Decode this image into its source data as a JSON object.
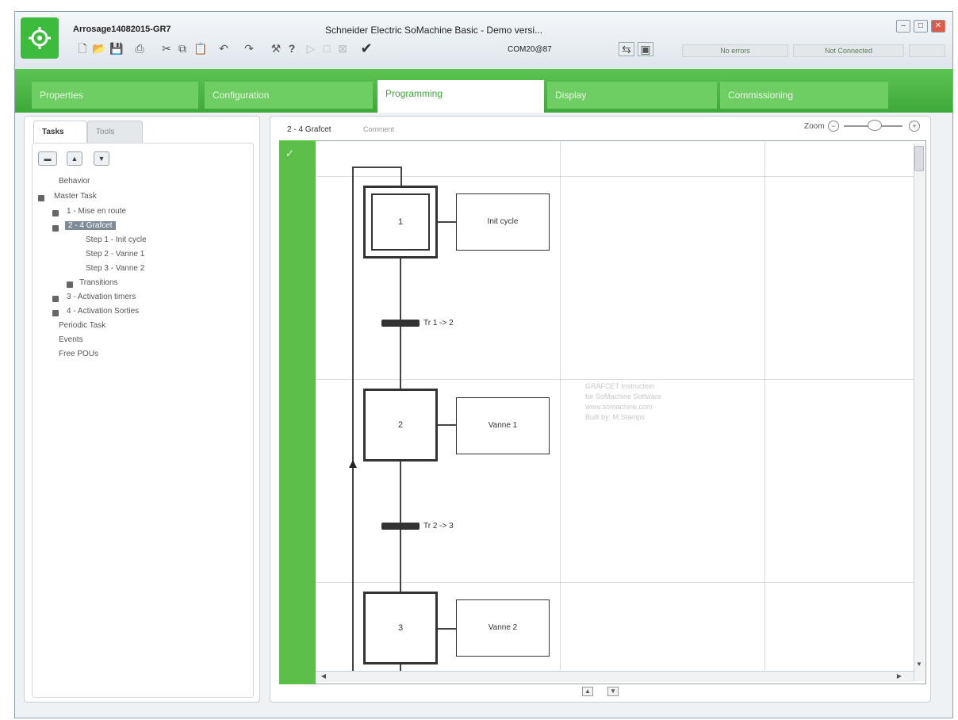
{
  "window": {
    "project_name": "Arrosage14082015-GR7",
    "title": "Schneider Electric SoMachine Basic - Demo versi...",
    "com_port": "COM20@87",
    "status_errors": "No errors",
    "status_connection": "Not Connected",
    "min_glyph": "–",
    "max_glyph": "□",
    "close_glyph": "✕"
  },
  "toolbar": {
    "icons": [
      "new-icon",
      "open-icon",
      "save-icon",
      "print-icon",
      "cut-icon",
      "copy-icon",
      "paste-icon",
      "undo-icon",
      "redo-icon",
      "tools-icon",
      "help-icon",
      "run-icon",
      "stop-icon",
      "reset-icon",
      "check-icon",
      "compare-icon",
      "monitor-icon"
    ],
    "glyphs": {
      "new": "🗋",
      "open": "📂",
      "save": "💾",
      "print": "⎙",
      "cut": "✂",
      "copy": "⧉",
      "paste": "📋",
      "undo": "↶",
      "redo": "↷",
      "tools": "⚒",
      "help": "?",
      "run": "▷",
      "stop": "□",
      "reset": "⊠",
      "check": "✔",
      "compare": "⇆",
      "monitor": "▣"
    }
  },
  "tabs": [
    "Properties",
    "Configuration",
    "Programming",
    "Display",
    "Commissioning"
  ],
  "active_tab": "Programming",
  "left_panel": {
    "subtabs": [
      "Tasks",
      "Tools"
    ],
    "buttons": {
      "add": "▬",
      "up": "▲",
      "down": "▼"
    },
    "tree": {
      "behavior": "Behavior",
      "master_task": "Master Task",
      "pou1": "1 - Mise en route",
      "pou2": "2 - 4 Grafcet",
      "step1": "Step 1 - Init cycle",
      "step2": "Step 2 - Vanne 1",
      "step3": "Step 3 - Vanne 2",
      "transitions": "Transitions",
      "pou3": "3 - Activation timers",
      "pou4": "4 - Activation Sorties",
      "periodic": "Periodic Task",
      "events": "Events",
      "free_pous": "Free POUs"
    }
  },
  "editor": {
    "title": "2 - 4 Grafcet",
    "comment": "Comment",
    "zoom_label": "Zoom",
    "zoom_minus": "−",
    "zoom_plus": "+",
    "check_glyph": "✓",
    "steps": [
      {
        "number": "1",
        "action": "Init cycle"
      },
      {
        "number": "2",
        "action": "Vanne 1"
      },
      {
        "number": "3",
        "action": "Vanne 2"
      }
    ],
    "transitions": [
      "Tr 1 -> 2",
      "Tr 2 -> 3"
    ],
    "watermark": [
      "GRAFCET Instruction",
      "for SoMachine Software",
      "www.somachine.com",
      "Built by: M.Stamps"
    ],
    "scroll": {
      "up": "▲",
      "down": "▼",
      "left": "◀",
      "right": "▶"
    },
    "nav": {
      "up": "▲",
      "down": "▼"
    }
  }
}
